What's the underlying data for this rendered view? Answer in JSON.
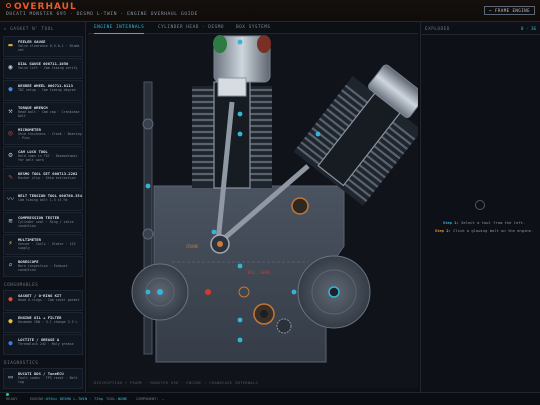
{
  "app": {
    "logo": "OVERHAUL",
    "subtitle": "DUCATI MONSTER 695 · DESMO L-TWIN · ENGINE OVERHAUL GUIDE",
    "exit_button": "← FRAME ENGINE"
  },
  "left_panel": {
    "tools_title": "▸ GASKET N' TOOL",
    "tools": [
      {
        "icon": "feeler-gauge-icon",
        "glyph": "📏",
        "name": "FEELER GAUGE",
        "desc": "Valve clearance 0.5-0.1 · Blade set"
      },
      {
        "icon": "dial-gauge-icon",
        "glyph": "🧭",
        "name": "DIAL GAUGE 000711.1050",
        "desc": "Valve lift · Cam timing verify"
      },
      {
        "icon": "degree-wheel-icon",
        "glyph": "🔵",
        "name": "DEGREE WHEEL 000711.0113",
        "desc": "TDC setup · Cam timing degree"
      },
      {
        "icon": "torque-wrench-icon",
        "glyph": "🔩",
        "name": "TORQUE WRENCH",
        "desc": "Head bolt · Cam cap · Crankcase bolt"
      },
      {
        "icon": "micrometer-icon",
        "glyph": "🎯",
        "name": "MICROMETER",
        "desc": "Shim thickness · Crank · Bearing · Pins"
      },
      {
        "icon": "cam-lock-icon",
        "glyph": "🔧",
        "name": "CAM LOCK TOOL",
        "desc": "Hold cams in TDC · Desmodromic for belt work"
      },
      {
        "icon": "desmo-tool-icon",
        "glyph": "🪛",
        "name": "DESMO TOOL SET 000713.2262",
        "desc": "Rocker clip · Shim extraction"
      },
      {
        "icon": "belt-tension-icon",
        "glyph": "〰",
        "name": "BELT TENSION TOOL 000760.3544",
        "desc": "Cam timing belt 1.5 ±1 Hz"
      },
      {
        "icon": "compression-tester-icon",
        "glyph": "💨",
        "name": "COMPRESSION TESTER",
        "desc": "Cylinder seal · Ring / valve condition"
      },
      {
        "icon": "multimeter-icon",
        "glyph": "⚡",
        "name": "MULTIMETER",
        "desc": "Sensor · Coils · Stator · 12V supply"
      },
      {
        "icon": "borescope-icon",
        "glyph": "🔭",
        "name": "BORESCOPE",
        "desc": "Bore inspection · Exhaust condition"
      }
    ],
    "consumables_title": "CONSUMABLES",
    "consumables": [
      {
        "icon": "gasket-kit-icon",
        "glyph": "🔴",
        "name": "GASKET / O-RING KIT",
        "desc": "Head O-rings · Cam cover gasket"
      },
      {
        "icon": "engine-oil-icon",
        "glyph": "🟡",
        "name": "ENGINE OIL + FILTER",
        "desc": "Desmodo 10W · 3.1 change 3.5 L"
      },
      {
        "icon": "loctite-icon",
        "glyph": "🔵",
        "name": "LOCTITE / GREASE A",
        "desc": "Threadlock 243 · Moly grease"
      }
    ],
    "diagnostics_title": "DIAGNOSTICS",
    "diagnostics": [
      {
        "icon": "laptop-icon",
        "glyph": "💻",
        "name": "DUCATI DDS / TuneECU",
        "desc": "Fault codes · TPS reset · Belt log"
      }
    ]
  },
  "tabs": [
    {
      "label": "ENGINE INTERNALS",
      "active": true
    },
    {
      "label": "CYLINDER HEAD · DESMO",
      "active": false
    },
    {
      "label": "BOX SYSTEMS",
      "active": false
    }
  ],
  "engine": {
    "part_labels": [
      "CRANK",
      "BAL. GEAR"
    ],
    "breadcrumb": "DESCRIPTION / FRAME · MONSTER 696 · ENGINE · CRANKCASE INTERNALS"
  },
  "right_panel": {
    "title": "EXPLODED",
    "count": "0 · 36",
    "hint1_step": "Step 1:",
    "hint1_text": "Select a tool from the left.",
    "hint2_step": "Step 2:",
    "hint2_text": "Click a glowing bolt on the engine."
  },
  "status": {
    "ready": "READY",
    "engine_label": "ENGINE:",
    "engine_value": "695cc DESMO L-TWIN · 73hp",
    "tool_label": "TOOL:",
    "tool_value": "NONE",
    "component_label": "COMPONENT:",
    "component_value": "—"
  },
  "colors": {
    "accent": "#33b6d6",
    "brand": "#e85a2a",
    "hint": "#e8923a"
  }
}
